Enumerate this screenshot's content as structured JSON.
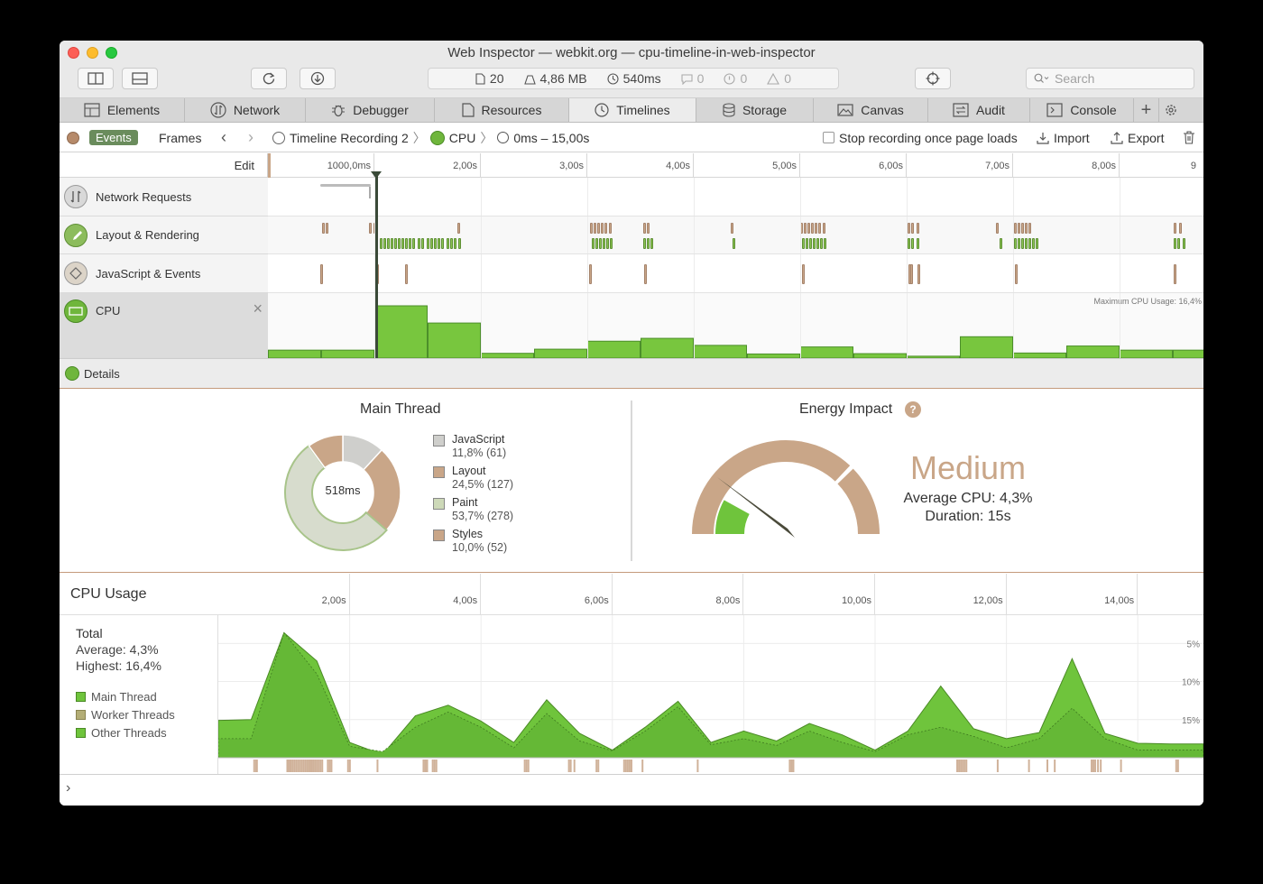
{
  "window_title": "Web Inspector — webkit.org — cpu-timeline-in-web-inspector",
  "dashboard": {
    "resources": "20",
    "size": "4,86 MB",
    "time": "540ms",
    "logs": "0",
    "errors": "0",
    "warnings": "0"
  },
  "search": {
    "placeholder": "Search"
  },
  "tabs": [
    "Elements",
    "Network",
    "Debugger",
    "Resources",
    "Timelines",
    "Storage",
    "Canvas",
    "Audit",
    "Console"
  ],
  "active_tab": "Timelines",
  "control": {
    "events": "Events",
    "frames": "Frames",
    "recording": "Timeline Recording 2",
    "instrument": "CPU",
    "range": "0ms – 15,00s",
    "stop_recording": "Stop recording once page loads",
    "import": "Import",
    "export": "Export"
  },
  "ruler": {
    "edit": "Edit",
    "ticks": [
      "1000,0ms",
      "2,00s",
      "3,00s",
      "4,00s",
      "5,00s",
      "6,00s",
      "7,00s",
      "8,00s",
      "9"
    ]
  },
  "timelines": [
    "Network Requests",
    "Layout & Rendering",
    "JavaScript & Events",
    "CPU"
  ],
  "max_cpu_label": "Maximum CPU Usage: 16,4%",
  "details_label": "Details",
  "main_thread": {
    "title": "Main Thread",
    "center": "518ms",
    "legend": [
      {
        "name": "JavaScript",
        "value": "11,8% (61)",
        "fraction": 0.118,
        "color": "#cfcfcc"
      },
      {
        "name": "Layout",
        "value": "24,5% (127)",
        "fraction": 0.245,
        "color": "#c9a688"
      },
      {
        "name": "Paint",
        "value": "53,7% (278)",
        "fraction": 0.537,
        "color": "#d7dccd"
      },
      {
        "name": "Styles",
        "value": "10,0% (52)",
        "fraction": 0.1,
        "color": "#c9a688"
      }
    ]
  },
  "energy": {
    "title": "Energy Impact",
    "help": "?",
    "level": "Medium",
    "average": "Average CPU: 4,3%",
    "duration": "Duration: 15s",
    "needle_fraction": 0.16
  },
  "cpu_usage": {
    "title": "CPU Usage",
    "axis_ticks": [
      "2,00s",
      "4,00s",
      "6,00s",
      "8,00s",
      "10,00s",
      "12,00s",
      "14,00s"
    ],
    "y_ticks": [
      "15%",
      "10%",
      "5%"
    ],
    "total_label": "Total",
    "average": "Average: 4,3%",
    "highest": "Highest: 16,4%",
    "legend": [
      "Main Thread",
      "Worker Threads",
      "Other Threads"
    ]
  },
  "chart_data": [
    {
      "type": "bar",
      "name_on_chart": "CPU",
      "x_unit": "s",
      "bar_width_s": 0.5,
      "x": [
        0.25,
        0.75,
        1.25,
        1.75,
        2.25,
        2.75,
        3.25,
        3.75,
        4.25,
        4.75,
        5.25,
        5.75,
        6.25,
        6.75,
        7.25,
        7.75,
        8.25,
        8.75
      ],
      "values": [
        2.5,
        2.5,
        16.4,
        11.0,
        1.5,
        2.8,
        5.3,
        6.2,
        4.0,
        1.3,
        3.5,
        1.4,
        0.6,
        6.7,
        1.6,
        3.8,
        2.5,
        2.5
      ],
      "ylim": [
        0,
        16.4
      ]
    },
    {
      "type": "area",
      "title": "CPU Usage",
      "x_unit": "s",
      "xlim": [
        0,
        15
      ],
      "ylim": [
        0,
        18
      ],
      "y_ticks": [
        5,
        10,
        15
      ],
      "x": [
        0,
        0.5,
        1.0,
        1.5,
        2.0,
        2.5,
        3.0,
        3.5,
        4.0,
        4.5,
        5.0,
        5.5,
        6.0,
        6.5,
        7.0,
        7.5,
        8.0,
        8.5,
        9.0,
        9.5,
        10.0,
        10.5,
        11.0,
        11.5,
        12.0,
        12.5,
        13.0,
        13.5,
        14.0,
        14.5,
        15.0
      ],
      "series": [
        {
          "name": "Main Thread",
          "values": [
            2.5,
            2.5,
            16.4,
            11.0,
            1.5,
            0.8,
            4.0,
            6.0,
            4.0,
            1.3,
            5.8,
            2.2,
            0.9,
            3.5,
            6.7,
            1.7,
            2.5,
            1.6,
            3.5,
            2.0,
            0.8,
            3.0,
            4.0,
            2.8,
            1.3,
            2.5,
            6.5,
            2.5,
            1.0,
            1.0,
            1.0
          ]
        },
        {
          "name": "Other Threads",
          "values": [
            4.9,
            5.0,
            16.4,
            12.7,
            2.0,
            0.4,
            5.5,
            6.9,
            4.8,
            2.0,
            7.6,
            3.2,
            1.0,
            4.0,
            7.4,
            2.0,
            3.5,
            2.2,
            4.5,
            3.0,
            1.0,
            3.5,
            9.4,
            3.8,
            2.5,
            3.3,
            13.0,
            3.2,
            1.9,
            1.8,
            1.8
          ]
        }
      ]
    }
  ]
}
